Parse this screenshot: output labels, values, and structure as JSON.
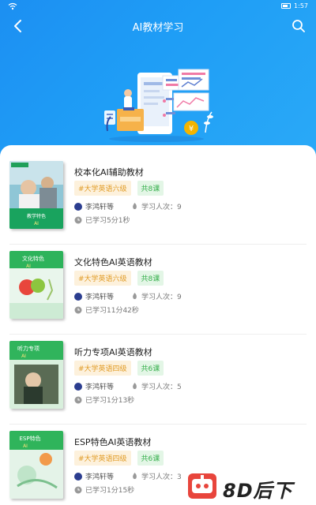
{
  "status_bar": {
    "time": "1:57"
  },
  "header": {
    "title": "AI教材学习"
  },
  "courses": [
    {
      "title": "校本化AI辅助教材",
      "level": "#大学英语六级",
      "lessons": "共8课",
      "author": "李鸿轩等",
      "learners": "学习人次：9",
      "studied": "已学习5分1秒",
      "cover_theme": "photo-people"
    },
    {
      "title": "文化特色AI英语教材",
      "level": "#大学英语六级",
      "lessons": "共8课",
      "author": "李鸿轩等",
      "learners": "学习人次：9",
      "studied": "已学习11分42秒",
      "cover_theme": "green-culture"
    },
    {
      "title": "听力专项AI英语教材",
      "level": "#大学英语四级",
      "lessons": "共6课",
      "author": "李鸿轩等",
      "learners": "学习人次：5",
      "studied": "已学习1分13秒",
      "cover_theme": "green-listening"
    },
    {
      "title": "ESP特色AI英语教材",
      "level": "#大学英语四级",
      "lessons": "共6课",
      "author": "李鸿轩等",
      "learners": "学习人次：3",
      "studied": "已学习1分15秒",
      "cover_theme": "green-esp"
    }
  ],
  "colors": {
    "header_blue": "#1f9ef6",
    "level_tag_bg": "#fdf1dc",
    "level_tag_text": "#e19b25",
    "count_tag_bg": "#e3f6e6",
    "count_tag_text": "#38b04e"
  },
  "watermark": {
    "text": "8D后下载"
  }
}
